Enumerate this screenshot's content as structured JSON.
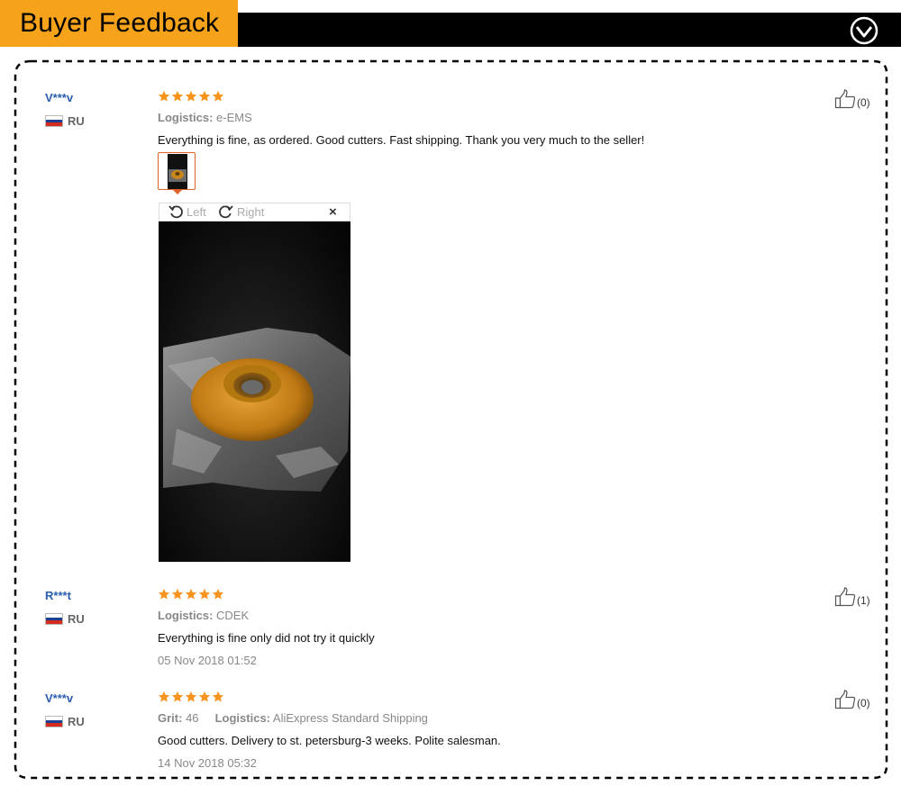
{
  "header": {
    "title": "Buyer Feedback",
    "toggle_icon": "chevron-down-circle-icon"
  },
  "colors": {
    "accent": "#f7a21b",
    "bar": "#000000",
    "link": "#2a5db0",
    "star": "#f7941d"
  },
  "reviews": [
    {
      "name": "V***v",
      "country": "RU",
      "rating": 5,
      "meta": [
        {
          "label": "Logistics:",
          "value": "e-EMS"
        }
      ],
      "comment": "Everything is fine, as ordered. Good cutters. Fast shipping. Thank you very much to the seller!",
      "helpful": "(0)",
      "viewer": {
        "left_label": "Left",
        "right_label": "Right",
        "close": "×"
      }
    },
    {
      "name": "R***t",
      "country": "RU",
      "rating": 5,
      "meta": [
        {
          "label": "Logistics:",
          "value": "CDEK"
        }
      ],
      "comment": "Everything is fine only did not try it quickly",
      "date": "05 Nov 2018 01:52",
      "helpful": "(1)"
    },
    {
      "name": "V***v",
      "country": "RU",
      "rating": 5,
      "meta": [
        {
          "label": "Grit:",
          "value": "46"
        },
        {
          "label": "Logistics:",
          "value": "AliExpress Standard Shipping"
        }
      ],
      "comment": "Good cutters. Delivery to st. petersburg-3 weeks. Polite salesman.",
      "date": "14 Nov 2018 05:32",
      "helpful": "(0)"
    }
  ]
}
